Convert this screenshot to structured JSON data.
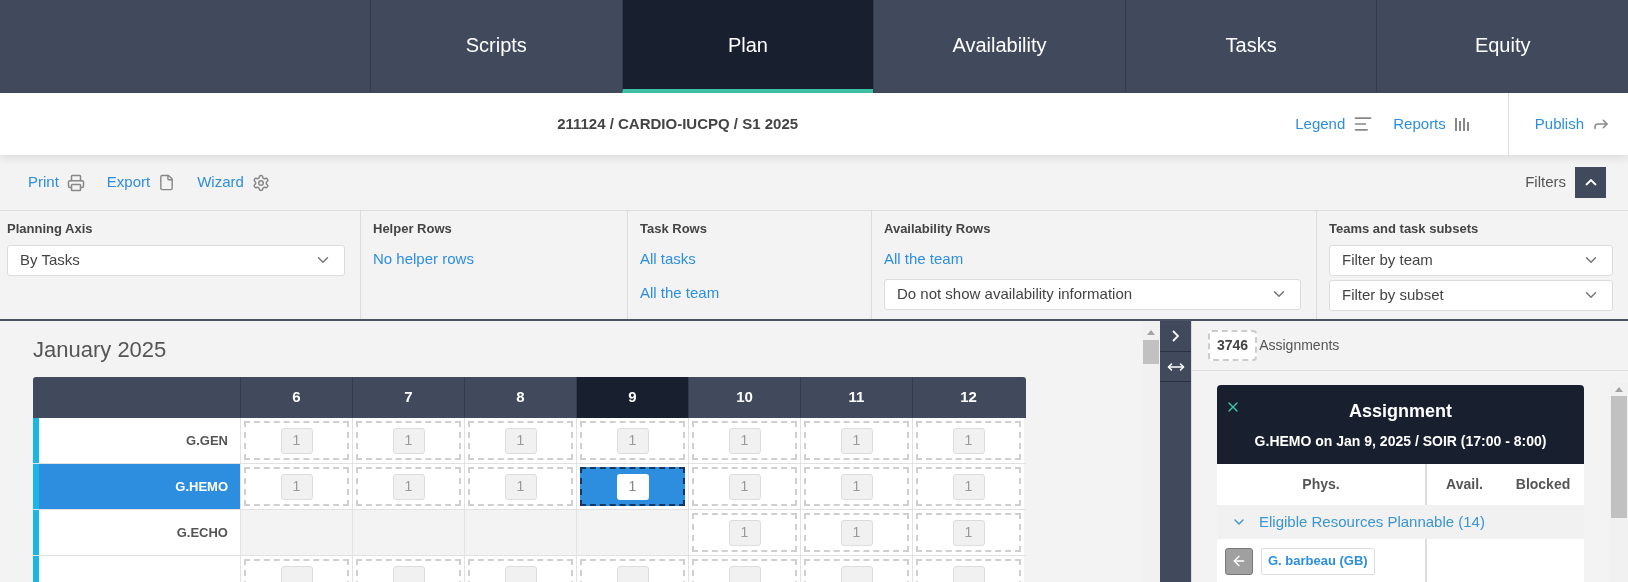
{
  "nav": {
    "tabs": [
      {
        "label": "Scripts",
        "selected": false
      },
      {
        "label": "Plan",
        "selected": true
      },
      {
        "label": "Availability",
        "selected": false
      },
      {
        "label": "Tasks",
        "selected": false
      },
      {
        "label": "Equity",
        "selected": false
      }
    ]
  },
  "header": {
    "title": "211124 / CARDIO-IUCPQ / S1 2025",
    "actions": [
      {
        "label": "Legend",
        "kind": "legend"
      },
      {
        "label": "Reports",
        "kind": "reports"
      },
      {
        "label": "Publish",
        "kind": "publish"
      }
    ]
  },
  "toolbar": {
    "actions": [
      {
        "label": "Print",
        "kind": "print"
      },
      {
        "label": "Export",
        "kind": "export"
      },
      {
        "label": "Wizard",
        "kind": "wizard"
      }
    ],
    "filters_label": "Filters",
    "filters_expanded": true
  },
  "filters": [
    {
      "heading": "Planning Axis",
      "items": [
        {
          "kind": "select",
          "text": "By Tasks"
        }
      ]
    },
    {
      "heading": "Helper Rows",
      "items": [
        {
          "kind": "link",
          "text": "No helper rows"
        }
      ]
    },
    {
      "heading": "Task Rows",
      "items": [
        {
          "kind": "link",
          "text": "All tasks"
        },
        {
          "kind": "link",
          "text": "All the team"
        }
      ]
    },
    {
      "heading": "Availability Rows",
      "items": [
        {
          "kind": "link",
          "text": "All the team"
        },
        {
          "kind": "select",
          "text": "Do not show availability information"
        }
      ]
    },
    {
      "heading": "Teams and task subsets",
      "items": [
        {
          "kind": "select",
          "text": "Filter by team"
        },
        {
          "kind": "select",
          "text": "Filter by subset"
        }
      ]
    }
  ],
  "calendar": {
    "month": "January 2025",
    "days": [
      {
        "label": "6",
        "selected": false
      },
      {
        "label": "7",
        "selected": false
      },
      {
        "label": "8",
        "selected": false
      },
      {
        "label": "9",
        "selected": true
      },
      {
        "label": "10",
        "selected": false
      },
      {
        "label": "11",
        "selected": false
      },
      {
        "label": "12",
        "selected": false
      }
    ],
    "rows": [
      {
        "label": "G.GEN",
        "selected": false,
        "cells": [
          {
            "kind": "slot",
            "count": "1",
            "selected": false
          },
          {
            "kind": "slot",
            "count": "1",
            "selected": false
          },
          {
            "kind": "slot",
            "count": "1",
            "selected": false
          },
          {
            "kind": "slot",
            "count": "1",
            "selected": false
          },
          {
            "kind": "slot",
            "count": "1",
            "selected": false
          },
          {
            "kind": "slot",
            "count": "1",
            "selected": false
          },
          {
            "kind": "slot",
            "count": "1",
            "selected": false
          }
        ]
      },
      {
        "label": "G.HEMO",
        "selected": true,
        "cells": [
          {
            "kind": "slot",
            "count": "1",
            "selected": false
          },
          {
            "kind": "slot",
            "count": "1",
            "selected": false
          },
          {
            "kind": "slot",
            "count": "1",
            "selected": false
          },
          {
            "kind": "slot",
            "count": "1",
            "selected": true
          },
          {
            "kind": "slot",
            "count": "1",
            "selected": false
          },
          {
            "kind": "slot",
            "count": "1",
            "selected": false
          },
          {
            "kind": "slot",
            "count": "1",
            "selected": false
          }
        ]
      },
      {
        "label": "G.ECHO",
        "selected": false,
        "cells": [
          {
            "kind": "empty"
          },
          {
            "kind": "empty"
          },
          {
            "kind": "empty"
          },
          {
            "kind": "empty"
          },
          {
            "kind": "slot",
            "count": "1",
            "selected": false
          },
          {
            "kind": "slot",
            "count": "1",
            "selected": false
          },
          {
            "kind": "slot",
            "count": "1",
            "selected": false
          }
        ]
      },
      {
        "selected": false,
        "cells": [
          {
            "kind": "slot",
            "selected": false
          },
          {
            "kind": "slot",
            "selected": false
          },
          {
            "kind": "slot",
            "selected": false
          },
          {
            "kind": "slot",
            "selected": false
          },
          {
            "kind": "slot",
            "selected": false
          },
          {
            "kind": "slot",
            "selected": false
          },
          {
            "kind": "slot",
            "selected": false
          }
        ]
      }
    ]
  },
  "side_panel": {
    "count": "3746",
    "count_label": "Assignments",
    "card": {
      "title": "Assignment",
      "subtitle": "G.HEMO on Jan 9, 2025 / SOIR (17:00 - 8:00)",
      "columns": [
        "Phys.",
        "Avail.",
        "Blocked"
      ],
      "group": {
        "label": "Eligible Resources Plannable (14)",
        "expanded": true
      },
      "resources": [
        {
          "name": "G. barbeau (GB)"
        }
      ]
    }
  }
}
